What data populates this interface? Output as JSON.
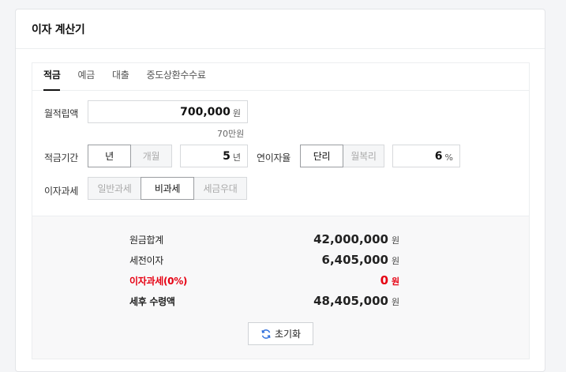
{
  "panel": {
    "title": "이자 계산기"
  },
  "tabs": [
    {
      "label": "적금",
      "active": true
    },
    {
      "label": "예금",
      "active": false
    },
    {
      "label": "대출",
      "active": false
    },
    {
      "label": "중도상환수수료",
      "active": false
    }
  ],
  "monthly": {
    "label": "월적립액",
    "value": "700,000",
    "unit": "원",
    "hint": "70만원"
  },
  "period": {
    "label": "적금기간",
    "opt_year": "년",
    "opt_month": "개월",
    "value": "5",
    "unit": "년"
  },
  "rate": {
    "label": "연이자율",
    "opt_simple": "단리",
    "opt_compound": "월복리",
    "value": "6",
    "unit": "%"
  },
  "tax": {
    "label": "이자과세",
    "opt_general": "일반과세",
    "opt_free": "비과세",
    "opt_preferential": "세금우대"
  },
  "results": {
    "principal": {
      "label": "원금합계",
      "value": "42,000,000",
      "unit": "원"
    },
    "pretax": {
      "label": "세전이자",
      "value": "6,405,000",
      "unit": "원"
    },
    "taxrow": {
      "label": "이자과세(0%)",
      "value": "0",
      "unit": "원"
    },
    "net": {
      "label": "세후 수령액",
      "value": "48,405,000",
      "unit": "원"
    }
  },
  "reset": {
    "label": "초기화",
    "icon": "refresh-icon",
    "icon_color": "#2f6fdc"
  },
  "colors": {
    "accent_red": "#e60012"
  }
}
